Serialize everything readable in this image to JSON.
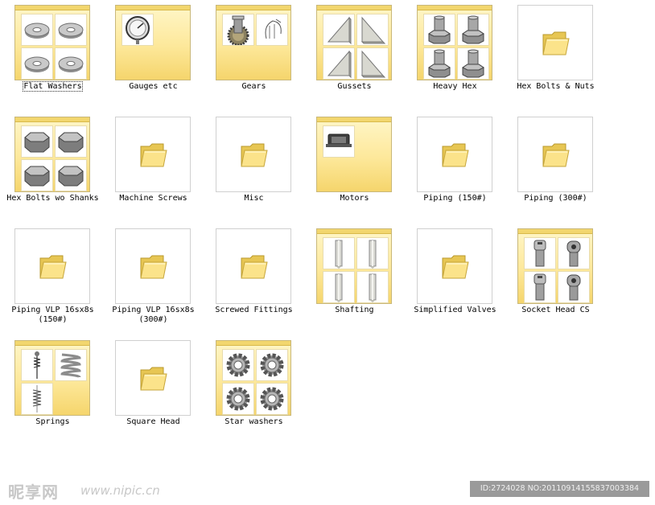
{
  "items": [
    {
      "label": "Flat Washers",
      "preview": "flat-washers",
      "selected": true
    },
    {
      "label": "Gauges etc",
      "preview": "gauges"
    },
    {
      "label": "Gears",
      "preview": "gears"
    },
    {
      "label": "Gussets",
      "preview": "gussets"
    },
    {
      "label": "Heavy Hex",
      "preview": "heavy-hex"
    },
    {
      "label": "Hex Bolts & Nuts",
      "preview": "folder"
    },
    {
      "label": "Hex Bolts wo Shanks",
      "preview": "hex-shanks"
    },
    {
      "label": "Machine Screws",
      "preview": "folder"
    },
    {
      "label": "Misc",
      "preview": "folder"
    },
    {
      "label": "Motors",
      "preview": "motors"
    },
    {
      "label": "Piping (150#)",
      "preview": "folder"
    },
    {
      "label": "Piping (300#)",
      "preview": "folder"
    },
    {
      "label": "Piping VLP 16sx8s (150#)",
      "preview": "folder"
    },
    {
      "label": "Piping VLP 16sx8s (300#)",
      "preview": "folder"
    },
    {
      "label": "Screwed Fittings",
      "preview": "folder"
    },
    {
      "label": "Shafting",
      "preview": "shafting"
    },
    {
      "label": "Simplified Valves",
      "preview": "folder"
    },
    {
      "label": "Socket Head CS",
      "preview": "socket-head"
    },
    {
      "label": "Springs",
      "preview": "springs"
    },
    {
      "label": "Square Head",
      "preview": "folder"
    },
    {
      "label": "Star washers",
      "preview": "star-washers"
    }
  ],
  "watermark": {
    "logo": "昵享网",
    "site": "www.nipic.cn",
    "id_text": "ID:2724028 NO:20110914155837003384"
  }
}
